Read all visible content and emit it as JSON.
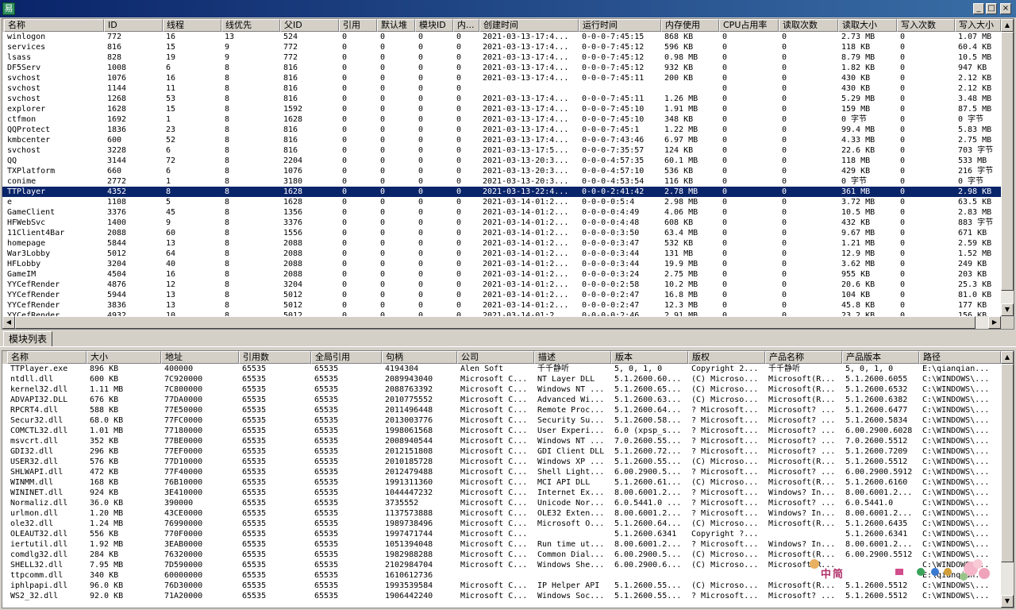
{
  "window": {
    "icon": "易",
    "min": "_",
    "max": "□",
    "close": "×"
  },
  "process_table": {
    "columns": [
      "名称",
      "ID",
      "线程",
      "线优先",
      "父ID",
      "引用",
      "默认堆",
      "模块ID",
      "内...",
      "创建时间",
      "运行时间",
      "内存使用",
      "CPU占用率",
      "读取次数",
      "读取大小",
      "写入次数",
      "写入大小"
    ],
    "rows": [
      [
        "winlogon",
        "772",
        "16",
        "13",
        "524",
        "0",
        "0",
        "0",
        "0",
        "2021-03-13-17:4...",
        "0-0-0-7:45:15",
        "868 KB",
        "0",
        "0",
        "2.73 MB",
        "0",
        "1.07 MB"
      ],
      [
        "services",
        "816",
        "15",
        "9",
        "772",
        "0",
        "0",
        "0",
        "0",
        "2021-03-13-17:4...",
        "0-0-0-7:45:12",
        "596 KB",
        "0",
        "0",
        "118 KB",
        "0",
        "60.4 KB"
      ],
      [
        "lsass",
        "828",
        "19",
        "9",
        "772",
        "0",
        "0",
        "0",
        "0",
        "2021-03-13-17:4...",
        "0-0-0-7:45:12",
        "0.98 MB",
        "0",
        "0",
        "8.79 MB",
        "0",
        "10.5 MB"
      ],
      [
        "DF5Serv",
        "1008",
        "6",
        "8",
        "816",
        "0",
        "0",
        "0",
        "0",
        "2021-03-13-17:4...",
        "0-0-0-7:45:12",
        "932 KB",
        "0",
        "0",
        "1.82 KB",
        "0",
        "947 KB"
      ],
      [
        "svchost",
        "1076",
        "16",
        "8",
        "816",
        "0",
        "0",
        "0",
        "0",
        "2021-03-13-17:4...",
        "0-0-0-7:45:11",
        "200 KB",
        "0",
        "0",
        "430 KB",
        "0",
        "2.12 KB"
      ],
      [
        "svchost",
        "1144",
        "11",
        "8",
        "816",
        "0",
        "0",
        "0",
        "0",
        "",
        "",
        "",
        "0",
        "0",
        "430 KB",
        "0",
        "2.12 KB"
      ],
      [
        "svchost",
        "1268",
        "53",
        "8",
        "816",
        "0",
        "0",
        "0",
        "0",
        "2021-03-13-17:4...",
        "0-0-0-7:45:11",
        "1.26 MB",
        "0",
        "0",
        "5.29 MB",
        "0",
        "3.48 MB"
      ],
      [
        "explorer",
        "1628",
        "15",
        "8",
        "1592",
        "0",
        "0",
        "0",
        "0",
        "2021-03-13-17:4...",
        "0-0-0-7:45:10",
        "1.91 MB",
        "0",
        "0",
        "159 MB",
        "0",
        "87.5 MB"
      ],
      [
        "ctfmon",
        "1692",
        "1",
        "8",
        "1628",
        "0",
        "0",
        "0",
        "0",
        "2021-03-13-17:4...",
        "0-0-0-7:45:10",
        "348 KB",
        "0",
        "0",
        "0 字节",
        "0",
        "0 字节"
      ],
      [
        "QQProtect",
        "1836",
        "23",
        "8",
        "816",
        "0",
        "0",
        "0",
        "0",
        "2021-03-13-17:4...",
        "0-0-0-7:45:1",
        "1.22 MB",
        "0",
        "0",
        "99.4 MB",
        "0",
        "5.83 MB"
      ],
      [
        "kmbcenter",
        "600",
        "52",
        "8",
        "816",
        "0",
        "0",
        "0",
        "0",
        "2021-03-13-17:4...",
        "0-0-0-7:43:46",
        "6.97 MB",
        "0",
        "0",
        "4.33 MB",
        "0",
        "2.75 MB"
      ],
      [
        "svchost",
        "3228",
        "6",
        "8",
        "816",
        "0",
        "0",
        "0",
        "0",
        "2021-03-13-17:5...",
        "0-0-0-7:35:57",
        "124 KB",
        "0",
        "0",
        "22.6 KB",
        "0",
        "703 字节"
      ],
      [
        "QQ",
        "3144",
        "72",
        "8",
        "2204",
        "0",
        "0",
        "0",
        "0",
        "2021-03-13-20:3...",
        "0-0-0-4:57:35",
        "60.1 MB",
        "0",
        "0",
        "118 MB",
        "0",
        "533 MB"
      ],
      [
        "TXPlatform",
        "660",
        "6",
        "8",
        "1076",
        "0",
        "0",
        "0",
        "0",
        "2021-03-13-20:3...",
        "0-0-0-4:57:10",
        "536 KB",
        "0",
        "0",
        "429 KB",
        "0",
        "216 字节"
      ],
      [
        "conime",
        "2772",
        "1",
        "8",
        "3180",
        "0",
        "0",
        "0",
        "0",
        "2021-03-13-20:3...",
        "0-0-0-4:53:54",
        "116 KB",
        "0",
        "0",
        "0 字节",
        "0",
        "0 字节"
      ],
      [
        "TTPlayer",
        "4352",
        "8",
        "8",
        "1628",
        "0",
        "0",
        "0",
        "0",
        "2021-03-13-22:4...",
        "0-0-0-2:41:42",
        "2.78 MB",
        "0",
        "0",
        "361 MB",
        "0",
        "2.98 KB"
      ],
      [
        "e",
        "1108",
        "5",
        "8",
        "1628",
        "0",
        "0",
        "0",
        "0",
        "2021-03-14-01:2...",
        "0-0-0-0:5:4",
        "2.98 MB",
        "0",
        "0",
        "3.72 MB",
        "0",
        "63.5 KB"
      ],
      [
        "GameClient",
        "3376",
        "45",
        "8",
        "1356",
        "0",
        "0",
        "0",
        "0",
        "2021-03-14-01:2...",
        "0-0-0-0:4:49",
        "4.06 MB",
        "0",
        "0",
        "10.5 MB",
        "0",
        "2.83 MB"
      ],
      [
        "HFWebSvc",
        "1400",
        "9",
        "8",
        "3376",
        "0",
        "0",
        "0",
        "0",
        "2021-03-14-01:2...",
        "0-0-0-0:4:48",
        "608 KB",
        "0",
        "0",
        "432 KB",
        "0",
        "883 字节"
      ],
      [
        "11Client4Bar",
        "2088",
        "60",
        "8",
        "1556",
        "0",
        "0",
        "0",
        "0",
        "2021-03-14-01:2...",
        "0-0-0-0:3:50",
        "63.4 MB",
        "0",
        "0",
        "9.67 MB",
        "0",
        "671 KB"
      ],
      [
        "homepage",
        "5844",
        "13",
        "8",
        "2088",
        "0",
        "0",
        "0",
        "0",
        "2021-03-14-01:2...",
        "0-0-0-0:3:47",
        "532 KB",
        "0",
        "0",
        "1.21 MB",
        "0",
        "2.59 KB"
      ],
      [
        "War3Lobby",
        "5012",
        "64",
        "8",
        "2088",
        "0",
        "0",
        "0",
        "0",
        "2021-03-14-01:2...",
        "0-0-0-0:3:44",
        "131 MB",
        "0",
        "0",
        "12.9 MB",
        "0",
        "1.52 MB"
      ],
      [
        "HFLobby",
        "3204",
        "40",
        "8",
        "2088",
        "0",
        "0",
        "0",
        "0",
        "2021-03-14-01:2...",
        "0-0-0-0:3:44",
        "19.9 MB",
        "0",
        "0",
        "3.62 MB",
        "0",
        "249 KB"
      ],
      [
        "GameIM",
        "4504",
        "16",
        "8",
        "2088",
        "0",
        "0",
        "0",
        "0",
        "2021-03-14-01:2...",
        "0-0-0-0:3:24",
        "2.75 MB",
        "0",
        "0",
        "955 KB",
        "0",
        "203 KB"
      ],
      [
        "YYCefRender",
        "4876",
        "12",
        "8",
        "3204",
        "0",
        "0",
        "0",
        "0",
        "2021-03-14-01:2...",
        "0-0-0-0:2:58",
        "10.2 MB",
        "0",
        "0",
        "20.6 KB",
        "0",
        "25.3 KB"
      ],
      [
        "YYCefRender",
        "5944",
        "13",
        "8",
        "5012",
        "0",
        "0",
        "0",
        "0",
        "2021-03-14-01:2...",
        "0-0-0-0:2:47",
        "16.8 MB",
        "0",
        "0",
        "104 KB",
        "0",
        "81.0 KB"
      ],
      [
        "YYCefRender",
        "3836",
        "13",
        "8",
        "5012",
        "0",
        "0",
        "0",
        "0",
        "2021-03-14-01:2...",
        "0-0-0-0:2:47",
        "12.3 MB",
        "0",
        "0",
        "45.8 KB",
        "0",
        "177 KB"
      ],
      [
        "YYCefRender",
        "4932",
        "10",
        "8",
        "5012",
        "0",
        "0",
        "0",
        "0",
        "2021-03-14-01:2...",
        "0-0-0-0:2:46",
        "2.91 MB",
        "0",
        "0",
        "23.2 KB",
        "0",
        "156 KB"
      ]
    ],
    "selected_row": 15
  },
  "tab": {
    "label": "模块列表"
  },
  "module_table": {
    "columns": [
      "名称",
      "大小",
      "地址",
      "引用数",
      "全局引用",
      "句柄",
      "公司",
      "描述",
      "版本",
      "版权",
      "产品名称",
      "产品版本",
      "路径"
    ],
    "rows": [
      [
        "TTPlayer.exe",
        "896 KB",
        "400000",
        "65535",
        "65535",
        "4194304",
        "Alen Soft",
        "千千静听",
        "5, 0, 1, 0",
        "Copyright 2...",
        "千千静听",
        "5, 0, 1, 0",
        "E:\\qianqian..."
      ],
      [
        "ntdll.dll",
        "600 KB",
        "7C920000",
        "65535",
        "65535",
        "2089943040",
        "Microsoft C...",
        "NT Layer DLL",
        "5.1.2600.60...",
        "(C) Microso...",
        "Microsoft(R...",
        "5.1.2600.6055",
        "C:\\WINDOWS\\..."
      ],
      [
        "kernel32.dll",
        "1.11 MB",
        "7C800000",
        "65535",
        "65535",
        "2088763392",
        "Microsoft C...",
        "Windows NT ...",
        "5.1.2600.65...",
        "(C) Microso...",
        "Microsoft(R...",
        "5.1.2600.6532",
        "C:\\WINDOWS\\..."
      ],
      [
        "ADVAPI32.DLL",
        "676 KB",
        "77DA0000",
        "65535",
        "65535",
        "2010775552",
        "Microsoft C...",
        "Advanced Wi...",
        "5.1.2600.63...",
        "(C) Microso...",
        "Microsoft(R...",
        "5.1.2600.6382",
        "C:\\WINDOWS\\..."
      ],
      [
        "RPCRT4.dll",
        "588 KB",
        "77E50000",
        "65535",
        "65535",
        "2011496448",
        "Microsoft C...",
        "Remote Proc...",
        "5.1.2600.64...",
        "? Microsoft...",
        "Microsoft? ...",
        "5.1.2600.6477",
        "C:\\WINDOWS\\..."
      ],
      [
        "Secur32.dll",
        "68.0 KB",
        "77FC0000",
        "65535",
        "65535",
        "2013003776",
        "Microsoft C...",
        "Security Su...",
        "5.1.2600.58...",
        "? Microsoft...",
        "Microsoft? ...",
        "5.1.2600.5834",
        "C:\\WINDOWS\\..."
      ],
      [
        "COMCTL32.dll",
        "1.01 MB",
        "77180000",
        "65535",
        "65535",
        "1998061568",
        "Microsoft C...",
        "User Experi...",
        "6.0 (xpsp_s...",
        "? Microsoft...",
        "Microsoft? ...",
        "6.00.2900.6028",
        "C:\\WINDOWS\\..."
      ],
      [
        "msvcrt.dll",
        "352 KB",
        "77BE0000",
        "65535",
        "65535",
        "2008940544",
        "Microsoft C...",
        "Windows NT ...",
        "7.0.2600.55...",
        "? Microsoft...",
        "Microsoft? ...",
        "7.0.2600.5512",
        "C:\\WINDOWS\\..."
      ],
      [
        "GDI32.dll",
        "296 KB",
        "77EF0000",
        "65535",
        "65535",
        "2012151808",
        "Microsoft C...",
        "GDI Client DLL",
        "5.1.2600.72...",
        "? Microsoft...",
        "Microsoft? ...",
        "5.1.2600.7209",
        "C:\\WINDOWS\\..."
      ],
      [
        "USER32.dll",
        "576 KB",
        "77D10000",
        "65535",
        "65535",
        "2010185728",
        "Microsoft C...",
        "Windows XP ...",
        "5.1.2600.55...",
        "(C) Microso...",
        "Microsoft(R...",
        "5.1.2600.5512",
        "C:\\WINDOWS\\..."
      ],
      [
        "SHLWAPI.dll",
        "472 KB",
        "77F40000",
        "65535",
        "65535",
        "2012479488",
        "Microsoft C...",
        "Shell Light...",
        "6.00.2900.5...",
        "? Microsoft...",
        "Microsoft? ...",
        "6.00.2900.5912",
        "C:\\WINDOWS\\..."
      ],
      [
        "WINMM.dll",
        "168 KB",
        "76B10000",
        "65535",
        "65535",
        "1991311360",
        "Microsoft C...",
        "MCI API DLL",
        "5.1.2600.61...",
        "(C) Microso...",
        "Microsoft(R...",
        "5.1.2600.6160",
        "C:\\WINDOWS\\..."
      ],
      [
        "WININET.dll",
        "924 KB",
        "3E410000",
        "65535",
        "65535",
        "1044447232",
        "Microsoft C...",
        "Internet Ex...",
        "8.00.6001.2...",
        "? Microsoft...",
        "Windows? In...",
        "8.00.6001.2...",
        "C:\\WINDOWS\\..."
      ],
      [
        "Normaliz.dll",
        "36.0 KB",
        "390000",
        "65535",
        "65535",
        "3735552",
        "Microsoft C...",
        "Unicode Nor...",
        "6.0.5441.0 ...",
        "? Microsoft...",
        "Microsoft? ...",
        "6.0.5441.0",
        "C:\\WINDOWS\\..."
      ],
      [
        "urlmon.dll",
        "1.20 MB",
        "43CE0000",
        "65535",
        "65535",
        "1137573888",
        "Microsoft C...",
        "OLE32 Exten...",
        "8.00.6001.2...",
        "? Microsoft...",
        "Windows? In...",
        "8.00.6001.2...",
        "C:\\WINDOWS\\..."
      ],
      [
        "ole32.dll",
        "1.24 MB",
        "76990000",
        "65535",
        "65535",
        "1989738496",
        "Microsoft C...",
        "Microsoft O...",
        "5.1.2600.64...",
        "(C) Microso...",
        "Microsoft(R...",
        "5.1.2600.6435",
        "C:\\WINDOWS\\..."
      ],
      [
        "OLEAUT32.dll",
        "556 KB",
        "770F0000",
        "65535",
        "65535",
        "1997471744",
        "Microsoft C...",
        "",
        "5.1.2600.6341",
        "Copyright ?...",
        "",
        "5.1.2600.6341",
        "C:\\WINDOWS\\..."
      ],
      [
        "iertutil.dll",
        "1.92 MB",
        "3EAB0000",
        "65535",
        "65535",
        "1051394048",
        "Microsoft C...",
        "Run time ut...",
        "8.00.6001.2...",
        "? Microsoft...",
        "Windows? In...",
        "8.00.6001.2...",
        "C:\\WINDOWS\\..."
      ],
      [
        "comdlg32.dll",
        "284 KB",
        "76320000",
        "65535",
        "65535",
        "1982988288",
        "Microsoft C...",
        "Common Dial...",
        "6.00.2900.5...",
        "(C) Microso...",
        "Microsoft(R...",
        "6.00.2900.5512",
        "C:\\WINDOWS\\..."
      ],
      [
        "SHELL32.dll",
        "7.95 MB",
        "7D590000",
        "65535",
        "65535",
        "2102984704",
        "Microsoft C...",
        "Windows She...",
        "6.00.2900.6...",
        "(C) Microso...",
        "Microsoft(R...",
        "",
        "C:\\WINDOWS\\..."
      ],
      [
        "ttpcomm.dll",
        "340 KB",
        "60000000",
        "65535",
        "65535",
        "1610612736",
        "",
        "",
        "",
        "",
        "",
        "",
        "E:\\qianqian..."
      ],
      [
        "iphlpapi.dll",
        "96.0 KB",
        "76D30000",
        "65535",
        "65535",
        "1993539584",
        "Microsoft C...",
        "IP Helper API",
        "5.1.2600.55...",
        "(C) Microso...",
        "Microsoft(R...",
        "5.1.2600.5512",
        "C:\\WINDOWS\\..."
      ],
      [
        "WS2_32.dll",
        "92.0 KB",
        "71A20000",
        "65535",
        "65535",
        "1906442240",
        "Microsoft C...",
        "Windows Soc...",
        "5.1.2600.55...",
        "? Microsoft...",
        "Microsoft? ...",
        "5.1.2600.5512",
        "C:\\WINDOWS\\..."
      ]
    ]
  },
  "ime_bar": {
    "text": "中简"
  },
  "colors": {
    "selection": "#0a246a",
    "titlebar": "#0a246a",
    "face": "#d4d0c8"
  }
}
